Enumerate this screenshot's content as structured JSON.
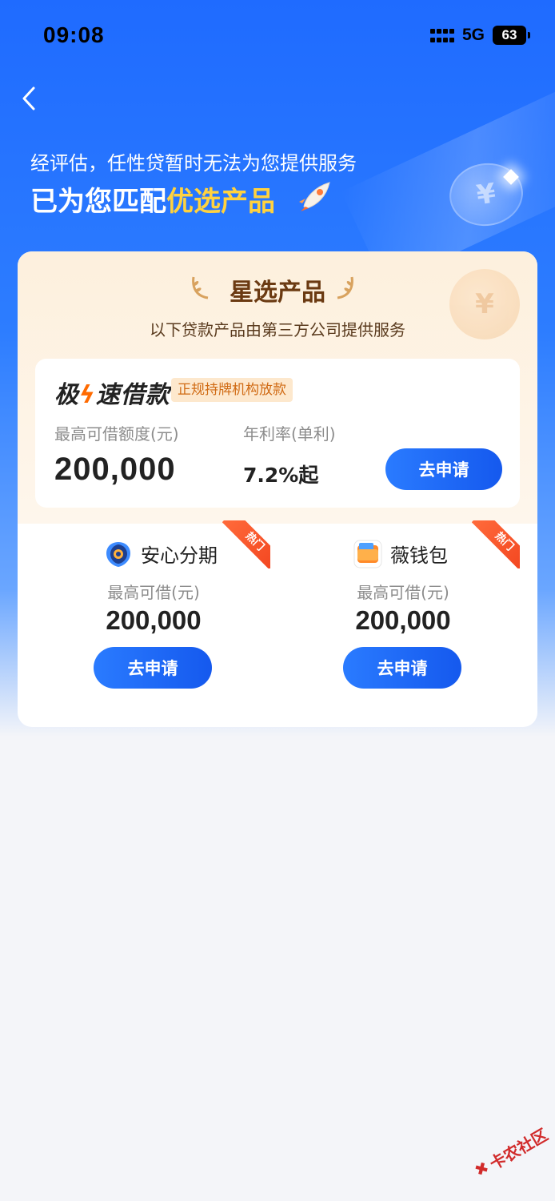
{
  "status_bar": {
    "time": "09:08",
    "network": "5G",
    "battery": "63"
  },
  "header": {
    "subtitle": "经评估，任性贷暂时无法为您提供服务",
    "headline_prefix": "已为您匹配",
    "headline_highlight": "优选产品"
  },
  "card": {
    "title": "星选产品",
    "subtitle": "以下贷款产品由第三方公司提供服务",
    "featured": {
      "name_part1": "极",
      "name_part2": "速借款",
      "badge": "正规持牌机构放款",
      "max_label": "最高可借额度(元)",
      "max_amount": "200,000",
      "rate_label": "年利率(单利)",
      "rate_value": "7.2%起",
      "apply_label": "去申请"
    },
    "products": [
      {
        "name": "安心分期",
        "hot": "热门",
        "label": "最高可借(元)",
        "amount": "200,000",
        "apply_label": "去申请"
      },
      {
        "name": "薇钱包",
        "hot": "热门",
        "label": "最高可借(元)",
        "amount": "200,000",
        "apply_label": "去申请"
      }
    ]
  },
  "watermark": "卡农社区",
  "colors": {
    "primary": "#1f6bff",
    "highlight": "#ffd23f",
    "title_brown": "#6b3a12",
    "hot": "#f2441f"
  }
}
